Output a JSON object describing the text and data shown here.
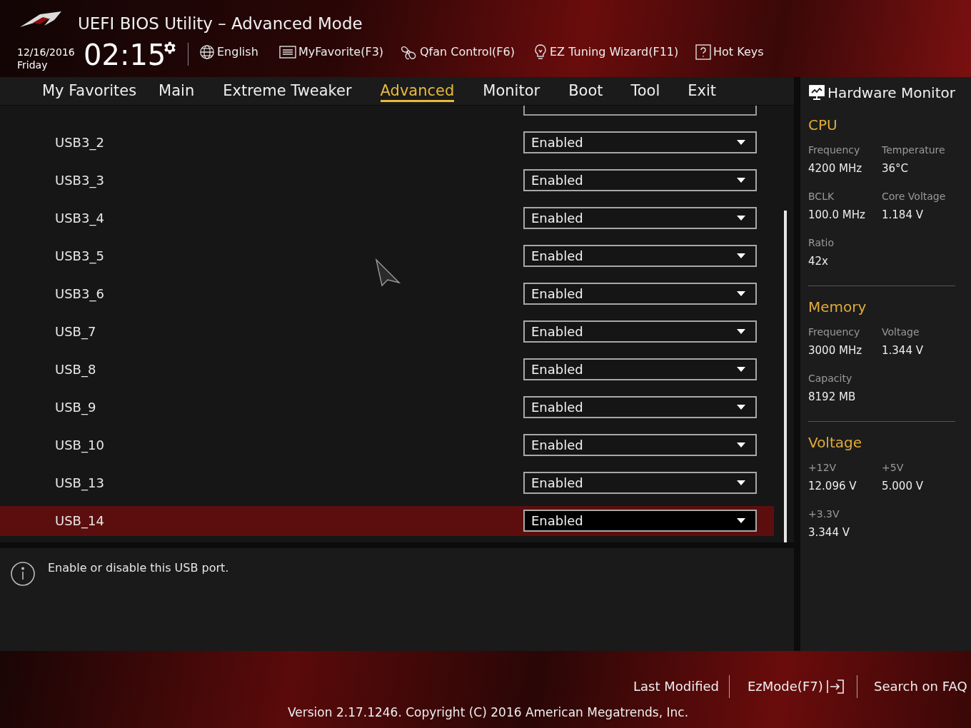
{
  "header": {
    "title": "UEFI BIOS Utility – Advanced Mode",
    "date": "12/16/2016",
    "day": "Friday",
    "time": "02:15",
    "toolbar": [
      {
        "label": "English"
      },
      {
        "label": "MyFavorite(F3)"
      },
      {
        "label": "Qfan Control(F6)"
      },
      {
        "label": "EZ Tuning Wizard(F11)"
      },
      {
        "label": "Hot Keys"
      }
    ]
  },
  "tabs": [
    {
      "label": "My Favorites",
      "selected": false
    },
    {
      "label": "Main",
      "selected": false
    },
    {
      "label": "Extreme Tweaker",
      "selected": false
    },
    {
      "label": "Advanced",
      "selected": true
    },
    {
      "label": "Monitor",
      "selected": false
    },
    {
      "label": "Boot",
      "selected": false
    },
    {
      "label": "Tool",
      "selected": false
    },
    {
      "label": "Exit",
      "selected": false
    }
  ],
  "settings": [
    {
      "label": "USB3_2",
      "value": "Enabled",
      "selected": false
    },
    {
      "label": "USB3_3",
      "value": "Enabled",
      "selected": false
    },
    {
      "label": "USB3_4",
      "value": "Enabled",
      "selected": false
    },
    {
      "label": "USB3_5",
      "value": "Enabled",
      "selected": false
    },
    {
      "label": "USB3_6",
      "value": "Enabled",
      "selected": false
    },
    {
      "label": "USB_7",
      "value": "Enabled",
      "selected": false
    },
    {
      "label": "USB_8",
      "value": "Enabled",
      "selected": false
    },
    {
      "label": "USB_9",
      "value": "Enabled",
      "selected": false
    },
    {
      "label": "USB_10",
      "value": "Enabled",
      "selected": false
    },
    {
      "label": "USB_13",
      "value": "Enabled",
      "selected": false
    },
    {
      "label": "USB_14",
      "value": "Enabled",
      "selected": true
    }
  ],
  "help_text": "Enable or disable this USB port.",
  "hardware_monitor": {
    "title": "Hardware Monitor",
    "sections": [
      {
        "title": "CPU",
        "items": [
          {
            "label": "Frequency",
            "value": "4200 MHz"
          },
          {
            "label": "Temperature",
            "value": "36°C"
          },
          {
            "label": "BCLK",
            "value": "100.0 MHz"
          },
          {
            "label": "Core Voltage",
            "value": "1.184 V"
          },
          {
            "label": "Ratio",
            "value": "42x"
          }
        ]
      },
      {
        "title": "Memory",
        "items": [
          {
            "label": "Frequency",
            "value": "3000 MHz"
          },
          {
            "label": "Voltage",
            "value": "1.344 V"
          },
          {
            "label": "Capacity",
            "value": "8192 MB"
          }
        ]
      },
      {
        "title": "Voltage",
        "items": [
          {
            "label": "+12V",
            "value": "12.096 V"
          },
          {
            "label": "+5V",
            "value": "5.000 V"
          },
          {
            "label": "+3.3V",
            "value": "3.344 V"
          }
        ]
      }
    ]
  },
  "footer": {
    "links": [
      "Last Modified",
      "EzMode(F7)",
      "Search on FAQ"
    ],
    "version": "Version 2.17.1246. Copyright (C) 2016 American Megatrends, Inc."
  }
}
